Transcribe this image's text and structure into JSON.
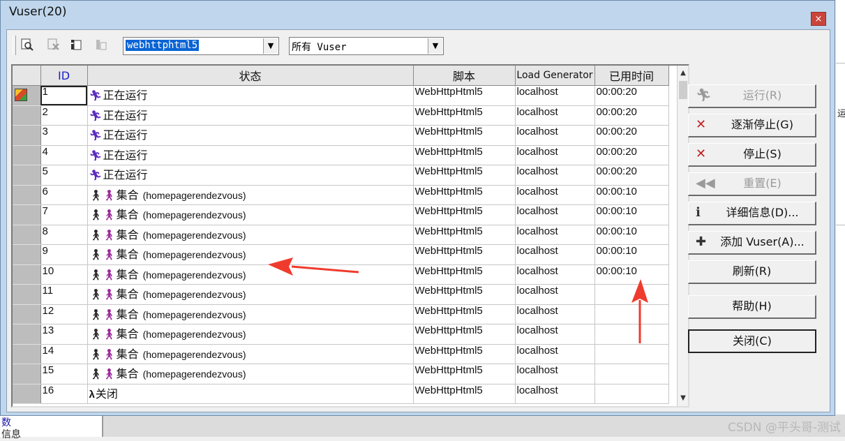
{
  "window": {
    "title": "Vuser(20)",
    "close_glyph": "×"
  },
  "toolbar": {
    "icons": [
      "find-icon",
      "detail-disabled-icon",
      "info-icon",
      "runtime-disabled-icon"
    ],
    "group_combo_value": "webhttphtml5",
    "filter_combo_value": "所有 Vuser",
    "combo_arrow_glyph": "▼"
  },
  "grid": {
    "columns": [
      "ID",
      "状态",
      "脚本",
      "Load Generator",
      "已用时间"
    ],
    "rows": [
      {
        "id": "1",
        "status": "正在运行",
        "status_type": "running",
        "extra": "",
        "script": "WebHttpHtml5",
        "lg": "localhost",
        "elapsed": "00:00:20"
      },
      {
        "id": "2",
        "status": "正在运行",
        "status_type": "running",
        "extra": "",
        "script": "WebHttpHtml5",
        "lg": "localhost",
        "elapsed": "00:00:20"
      },
      {
        "id": "3",
        "status": "正在运行",
        "status_type": "running",
        "extra": "",
        "script": "WebHttpHtml5",
        "lg": "localhost",
        "elapsed": "00:00:20"
      },
      {
        "id": "4",
        "status": "正在运行",
        "status_type": "running",
        "extra": "",
        "script": "WebHttpHtml5",
        "lg": "localhost",
        "elapsed": "00:00:20"
      },
      {
        "id": "5",
        "status": "正在运行",
        "status_type": "running",
        "extra": "",
        "script": "WebHttpHtml5",
        "lg": "localhost",
        "elapsed": "00:00:20"
      },
      {
        "id": "6",
        "status": "集合",
        "status_type": "rendezvous",
        "extra": "(homepagerendezvous)",
        "script": "WebHttpHtml5",
        "lg": "localhost",
        "elapsed": "00:00:10"
      },
      {
        "id": "7",
        "status": "集合",
        "status_type": "rendezvous",
        "extra": "(homepagerendezvous)",
        "script": "WebHttpHtml5",
        "lg": "localhost",
        "elapsed": "00:00:10"
      },
      {
        "id": "8",
        "status": "集合",
        "status_type": "rendezvous",
        "extra": "(homepagerendezvous)",
        "script": "WebHttpHtml5",
        "lg": "localhost",
        "elapsed": "00:00:10"
      },
      {
        "id": "9",
        "status": "集合",
        "status_type": "rendezvous",
        "extra": "(homepagerendezvous)",
        "script": "WebHttpHtml5",
        "lg": "localhost",
        "elapsed": "00:00:10"
      },
      {
        "id": "10",
        "status": "集合",
        "status_type": "rendezvous",
        "extra": "(homepagerendezvous)",
        "script": "WebHttpHtml5",
        "lg": "localhost",
        "elapsed": "00:00:10"
      },
      {
        "id": "11",
        "status": "集合",
        "status_type": "rendezvous",
        "extra": "(homepagerendezvous)",
        "script": "WebHttpHtml5",
        "lg": "localhost",
        "elapsed": ""
      },
      {
        "id": "12",
        "status": "集合",
        "status_type": "rendezvous",
        "extra": "(homepagerendezvous)",
        "script": "WebHttpHtml5",
        "lg": "localhost",
        "elapsed": ""
      },
      {
        "id": "13",
        "status": "集合",
        "status_type": "rendezvous",
        "extra": "(homepagerendezvous)",
        "script": "WebHttpHtml5",
        "lg": "localhost",
        "elapsed": ""
      },
      {
        "id": "14",
        "status": "集合",
        "status_type": "rendezvous",
        "extra": "(homepagerendezvous)",
        "script": "WebHttpHtml5",
        "lg": "localhost",
        "elapsed": ""
      },
      {
        "id": "15",
        "status": "集合",
        "status_type": "rendezvous",
        "extra": "(homepagerendezvous)",
        "script": "WebHttpHtml5",
        "lg": "localhost",
        "elapsed": ""
      },
      {
        "id": "16",
        "status": "关闭",
        "status_type": "down",
        "extra": "",
        "script": "WebHttpHtml5",
        "lg": "localhost",
        "elapsed": ""
      }
    ]
  },
  "buttons": {
    "run": "运行(R)",
    "gradual_stop": "逐渐停止(G)",
    "stop": "停止(S)",
    "reset": "重置(E)",
    "details": "详细信息(D)...",
    "add_vuser": "添加 Vuser(A)...",
    "refresh": "刷新(R)",
    "help": "帮助(H)",
    "close": "关闭(C)"
  },
  "background": {
    "left_text_1": "数",
    "left_text_2": "信息",
    "right_edge_text": "运",
    "watermark": "CSDN @平头哥-测试"
  },
  "colors": {
    "arrow": "#ef3b2d",
    "selection": "#0a64d4",
    "id_header": "#1b22c8"
  }
}
